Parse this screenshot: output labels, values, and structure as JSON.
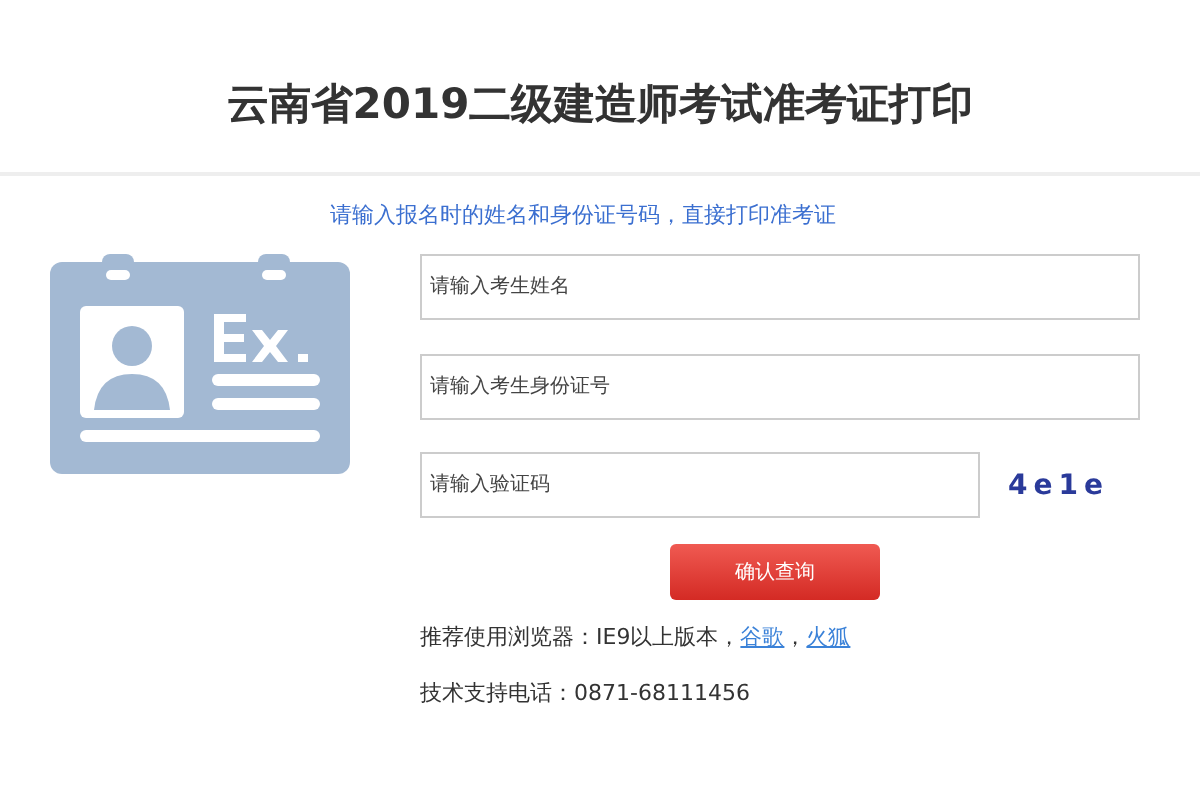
{
  "title": "云南省2019二级建造师考试准考证打印",
  "subtitle": "请输入报名时的姓名和身份证号码，直接打印准考证",
  "fields": [
    {
      "placeholder": "请输入考生姓名"
    },
    {
      "placeholder": "请输入考生身份证号"
    }
  ],
  "captcha": {
    "placeholder": "请输入验证码",
    "code": "4e1e"
  },
  "submit": "确认查询",
  "browser_note": {
    "text": "推荐使用浏览器：IE9以上版本，",
    "links": [
      "谷歌",
      "火狐"
    ],
    "separator": "，"
  },
  "support": "技术支持电话：0871-68111456"
}
